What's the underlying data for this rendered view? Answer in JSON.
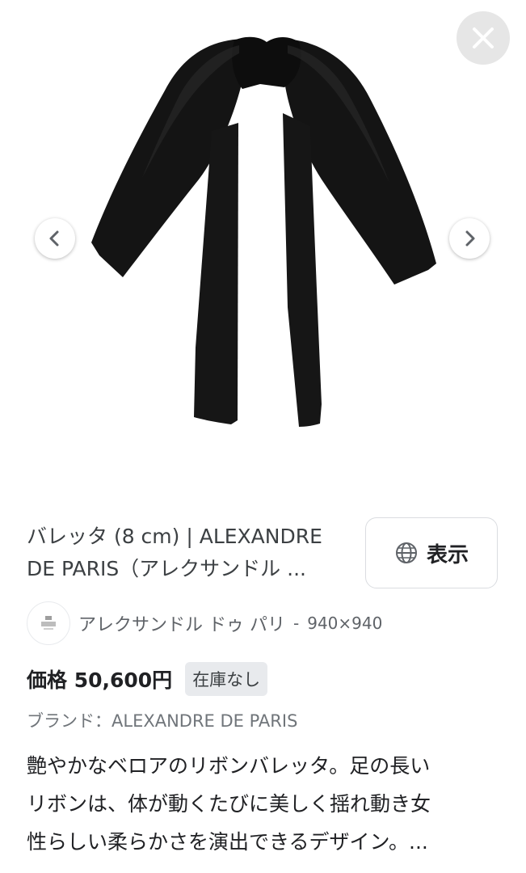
{
  "viewer": {
    "close_label": "Close",
    "prev_label": "Previous",
    "next_label": "Next"
  },
  "result": {
    "title_line1": "バレッタ (8 cm) | ALEXANDRE",
    "title_line2": "DE PARIS（アレクサンドル ...",
    "view_button_label": "表示",
    "source_name": "アレクサンドル ドゥ パリ",
    "source_separator": "-",
    "image_dimensions": "940×940",
    "price": "価格 50,600円",
    "stock_status": "在庫なし",
    "brand": "ブランド：ALEXANDRE DE PARIS",
    "description_line1": "艶やかなベロアのリボンバレッタ。足の長い",
    "description_line2": "リボンは、体が動くたびに美しく揺れ動き女",
    "description_line3": "性らしい柔らかさを演出できるデザイン。..."
  },
  "icons": {
    "close": "close-icon",
    "prev": "chevron-left-icon",
    "next": "chevron-right-icon",
    "globe": "globe-icon",
    "favicon": "site-favicon-icon"
  },
  "colors": {
    "ribbon": "#121212",
    "close_bg": "#e6e6e6",
    "badge_bg": "#e8eaed",
    "muted_text": "#5f6368"
  }
}
